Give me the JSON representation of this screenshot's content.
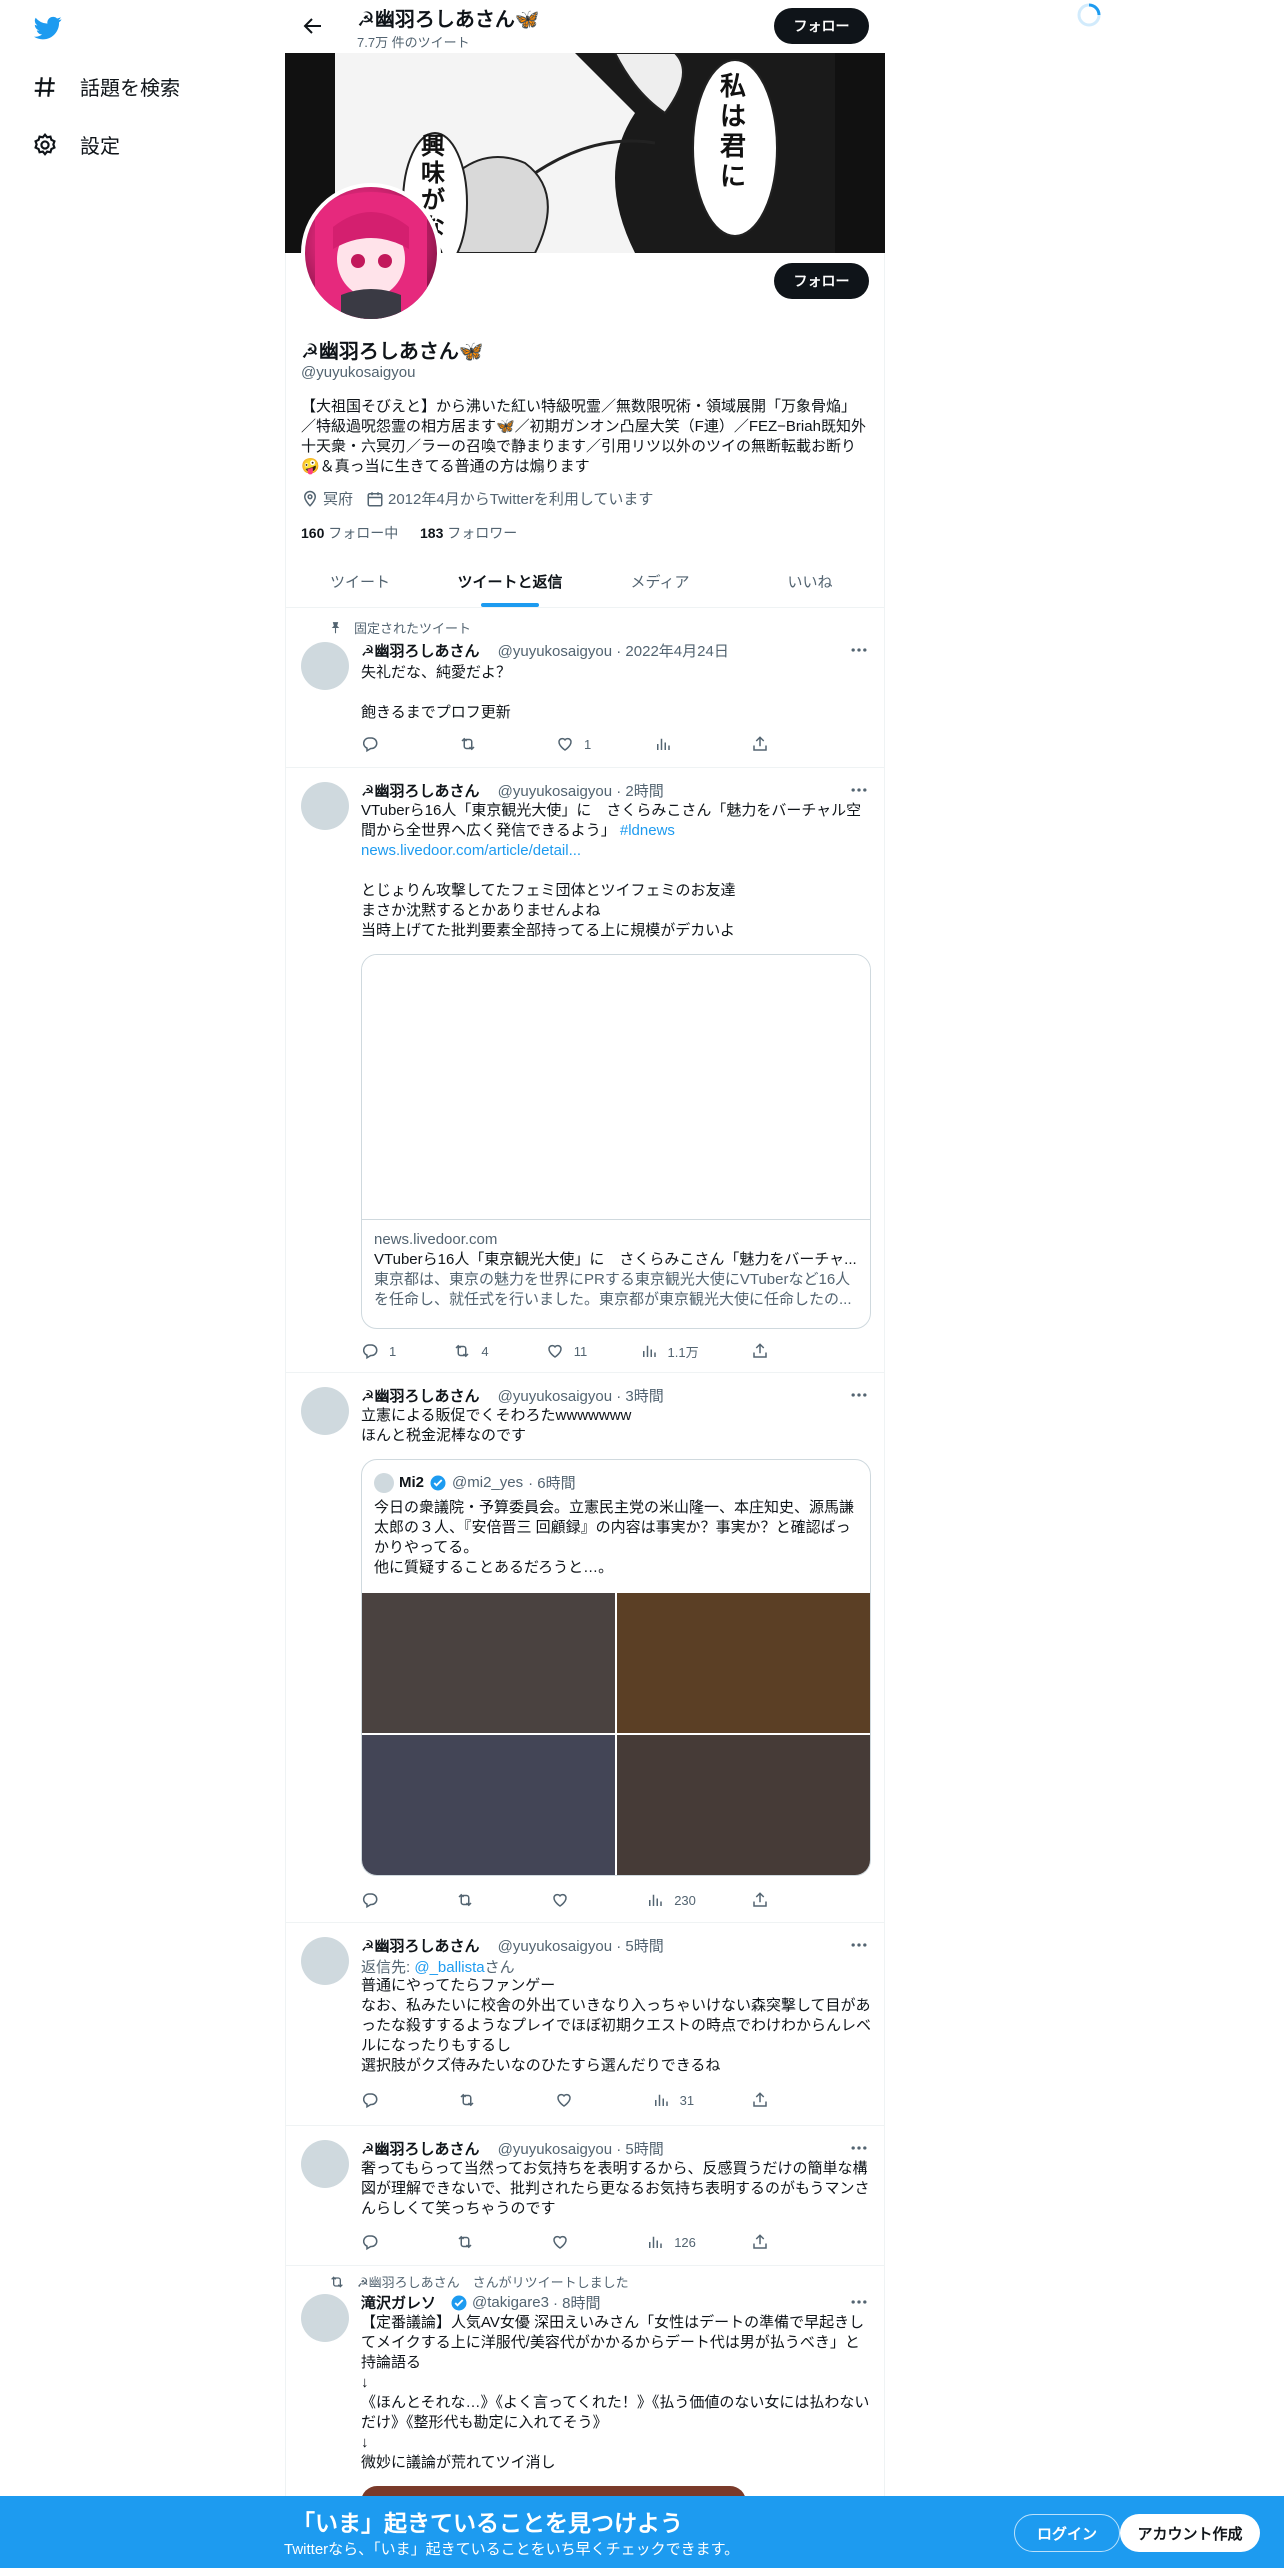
{
  "nav": {
    "explore_label": "話題を検索",
    "settings_label": "設定"
  },
  "header": {
    "name": "☭幽羽ろしあさん🦋",
    "tweet_count": "7.7万 件のツイート",
    "follow_label": "フォロー"
  },
  "banner": {
    "bubble_1": "私は君に",
    "bubble_2": "興味がない"
  },
  "profile": {
    "follow_label": "フォロー",
    "name": "☭幽羽ろしあさん🦋",
    "handle": "@yuyukosaigyou",
    "bio": "【大祖国そびえと】から沸いた紅い特級呪霊／無数限呪術・領域展開「万象骨焔」／特級過呪怨霊の相方居ます🦋／初期ガンオン凸屋大笑（F連）／FEZ−Briah既知外十天衆・六冥刃／ラーの召喚で静まります／引用リツ以外のツイの無断転載お断り🤪＆真っ当に生きてる普通の方は煽ります",
    "location": "冥府",
    "joined": "2012年4月からTwitterを利用しています",
    "following_count": "160",
    "following_label": "フォロー中",
    "followers_count": "183",
    "followers_label": "フォロワー"
  },
  "tabs": [
    "ツイート",
    "ツイートと返信",
    "メディア",
    "いいね"
  ],
  "active_tab": "ツイートと返信",
  "tweets": [
    {
      "pinned_label": "固定されたツイート",
      "name": "☭幽羽ろしあさん",
      "handle": "@yuyukosaigyou",
      "time": "· 2022年4月24日",
      "text": "失礼だな、純愛だよ？\n\n飽きるまでプロフ更新",
      "replies": "",
      "retweets": "",
      "likes": "1",
      "views": ""
    },
    {
      "name": "☭幽羽ろしあさん",
      "handle": "@yuyukosaigyou",
      "time": "· 2時間",
      "text_1": "VTuberら16人「東京観光大使」に　さくらみこさん「魅力をバーチャル空間から全世界へ広く発信できるよう」",
      "hashtag": "#ldnews",
      "link": "news.livedoor.com/article/detail...",
      "text_2": "とじょりん攻撃してたフェミ団体とツイフェミのお友達\nまさか沈黙するとかありませんよね\n当時上げてた批判要素全部持ってる上に規模がデカいよ",
      "card_domain": "news.livedoor.com",
      "card_title": "VTuberら16人「東京観光大使」に　さくらみこさん「魅力をバーチャ...",
      "card_desc": "東京都は、東京の魅力を世界にPRする東京観光大使にVTuberなど16人を任命し、就任式を行いました。東京都が東京観光大使に任命したの...",
      "replies": "1",
      "retweets": "4",
      "likes": "11",
      "views": "1.1万"
    },
    {
      "name": "☭幽羽ろしあさん",
      "handle": "@yuyukosaigyou",
      "time": "· 3時間",
      "text": "立憲による販促でくそわろたwwwwwww\nほんと税金泥棒なのです",
      "quote_name": "Mi2",
      "quote_handle": "@mi2_yes",
      "quote_time": "· 6時間",
      "quote_text": "今日の衆議院・予算委員会。立憲民主党の米山隆一、本庄知史、源馬謙太郎の３人、『安倍晋三 回顧録』の内容は事実か？事実か？と確認ばっかりやってる。\n他に質疑することあるだろうと…。",
      "replies": "",
      "retweets": "",
      "likes": "",
      "views": "230"
    },
    {
      "name": "☭幽羽ろしあさん",
      "handle": "@yuyukosaigyou",
      "time": "· 5時間",
      "reply_to_label": "返信先:",
      "reply_to_handle": "@_ballista",
      "reply_to_suffix": "さん",
      "text": "普通にやってたらファンゲー\nなお、私みたいに校舎の外出ていきなり入っちゃいけない森突撃して目があったな殺すするようなプレイでほぼ初期クエストの時点でわけわからんレベルになったりもするし\n選択肢がクズ侍みたいなのひたすら選んだりできるね",
      "replies": "",
      "retweets": "",
      "likes": "",
      "views": "31"
    },
    {
      "name": "☭幽羽ろしあさん",
      "handle": "@yuyukosaigyou",
      "time": "· 5時間",
      "text": "奢ってもらって当然ってお気持ちを表明するから、反感買うだけの簡単な構図が理解できないで、批判されたら更なるお気持ち表明するのがもうマンさんらしくて笑っちゃうのです",
      "replies": "",
      "retweets": "",
      "likes": "",
      "views": "126"
    },
    {
      "retweeted_by": "☭幽羽ろしあさん　さんがリツイートしました",
      "name": "滝沢ガレソ",
      "handle": "@takigare3",
      "time": "· 8時間",
      "text": "【定番議論】人気AV女優 深田えいみさん「女性はデートの準備で早起きしてメイクする上に洋服代/美容代がかかるからデート代は男が払うべき」と持論語る\n↓\n《ほんとそれな…》《よく言ってくれた！》《払う価値のない女には払わないだけ》《整形代も勘定に入れてそう》\n↓\n微妙に議論が荒れてツイ消し"
    }
  ],
  "bottom_bar": {
    "title": "「いま」起きていることを見つけよう",
    "subtitle": "Twitterなら、「いま」起きていることをいち早くチェックできます。",
    "login_label": "ログイン",
    "signup_label": "アカウント作成"
  },
  "colors": {
    "accent": "#1d9bf0",
    "text": "#0f1419",
    "muted": "#536471",
    "border": "#eff3f4"
  }
}
